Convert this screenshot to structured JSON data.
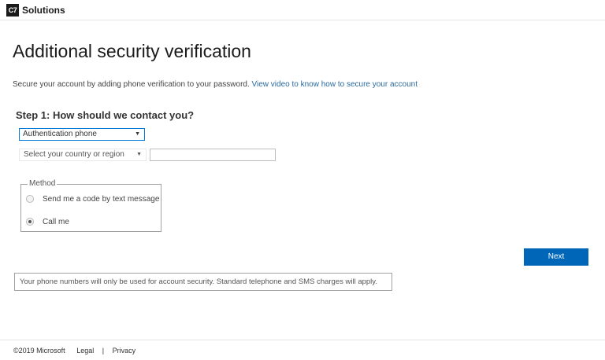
{
  "header": {
    "logo_mark": "C7",
    "logo_text": "Solutions"
  },
  "page": {
    "title": "Additional security verification",
    "subtitle": "Secure your account by adding phone verification to your password.",
    "video_link": "View video to know how to secure your account"
  },
  "step": {
    "heading": "Step 1: How should we contact you?",
    "contact_method_selected": "Authentication phone",
    "country_selected": "Select your country or region",
    "phone_value": ""
  },
  "method": {
    "legend": "Method",
    "options": [
      {
        "label": "Send me a code by text message",
        "checked": false
      },
      {
        "label": "Call me",
        "checked": true
      }
    ]
  },
  "actions": {
    "next_label": "Next"
  },
  "notice": {
    "text": "Your phone numbers will only be used for account security. Standard telephone and SMS charges will apply."
  },
  "footer": {
    "copyright": "©2019 Microsoft",
    "legal": "Legal",
    "separator": "|",
    "privacy": "Privacy"
  },
  "icons": {
    "dropdown": "chevron-down-icon"
  },
  "colors": {
    "accent": "#0067b8",
    "link": "#2b6a9e",
    "focus_border": "#0078d7"
  }
}
